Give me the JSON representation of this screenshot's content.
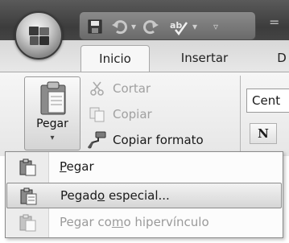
{
  "titlebar": {
    "right_glyph": "="
  },
  "tabs": [
    {
      "label": "Inicio",
      "active": true
    },
    {
      "label": "Insertar",
      "active": false
    },
    {
      "label": "D",
      "active": false
    }
  ],
  "clipboard": {
    "paste_label": "Pegar",
    "paste_dropdown": "▾",
    "cut_label": "Cortar",
    "copy_label": "Copiar",
    "format_painter_label": "Copiar formato"
  },
  "font": {
    "font_name": "Cent",
    "bold_label": "N"
  },
  "paste_menu": {
    "items": [
      {
        "pre": "",
        "mnemonic": "P",
        "post": "egar",
        "state": "normal"
      },
      {
        "pre": "Pegad",
        "mnemonic": "o",
        "post": " especial...",
        "state": "hover"
      },
      {
        "pre": "Pegar co",
        "mnemonic": "m",
        "post": "o hipervínculo",
        "state": "disabled"
      }
    ]
  },
  "icons": {
    "office_button": "office-logo-icon",
    "save": "save-icon",
    "undo": "undo-icon",
    "redo": "redo-icon",
    "spelling": "spelling-icon",
    "cut": "scissors-icon",
    "copy": "copy-icon",
    "format_painter": "brush-icon",
    "paste": "clipboard-icon"
  }
}
